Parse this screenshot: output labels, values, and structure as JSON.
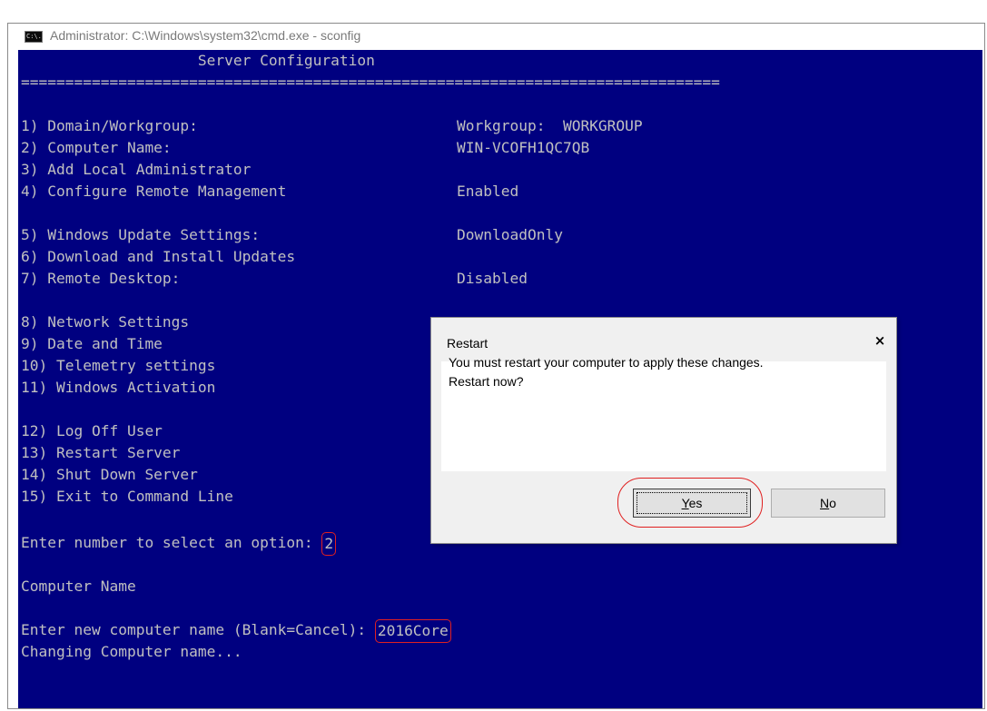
{
  "window": {
    "title": "Administrator: C:\\Windows\\system32\\cmd.exe - sconfig",
    "icon": "cmd-icon",
    "icon_text": "C:\\."
  },
  "console": {
    "header": "                    Server Configuration",
    "divider": "===============================================================================",
    "menu": [
      {
        "label": "1) Domain/Workgroup:",
        "value": "Workgroup:  WORKGROUP"
      },
      {
        "label": "2) Computer Name:",
        "value": "WIN-VCOFH1QC7QB"
      },
      {
        "label": "3) Add Local Administrator",
        "value": ""
      },
      {
        "label": "4) Configure Remote Management",
        "value": "Enabled"
      },
      {
        "label": "5) Windows Update Settings:",
        "value": "DownloadOnly"
      },
      {
        "label": "6) Download and Install Updates",
        "value": ""
      },
      {
        "label": "7) Remote Desktop:",
        "value": "Disabled"
      },
      {
        "label": "8) Network Settings",
        "value": ""
      },
      {
        "label": "9) Date and Time",
        "value": ""
      },
      {
        "label": "10) Telemetry settings",
        "value": ""
      },
      {
        "label": "11) Windows Activation",
        "value": ""
      },
      {
        "label": "12) Log Off User",
        "value": ""
      },
      {
        "label": "13) Restart Server",
        "value": ""
      },
      {
        "label": "14) Shut Down Server",
        "value": ""
      },
      {
        "label": "15) Exit to Command Line",
        "value": ""
      }
    ],
    "prompt": "Enter number to select an option: ",
    "prompt_input": "2",
    "section_title": "Computer Name",
    "name_prompt": "Enter new computer name (Blank=Cancel): ",
    "name_input": "2016Core",
    "status": "Changing Computer name..."
  },
  "dialog": {
    "title": "Restart",
    "close_label": "×",
    "message_line1": "You must restart your computer to apply these changes.",
    "message_line2": "Restart now?",
    "yes_accel": "Y",
    "yes_rest": "es",
    "no_accel": "N",
    "no_rest": "o"
  },
  "colors": {
    "console_bg": "#000080",
    "console_text": "#c0c0c0",
    "highlight": "#e02020"
  }
}
